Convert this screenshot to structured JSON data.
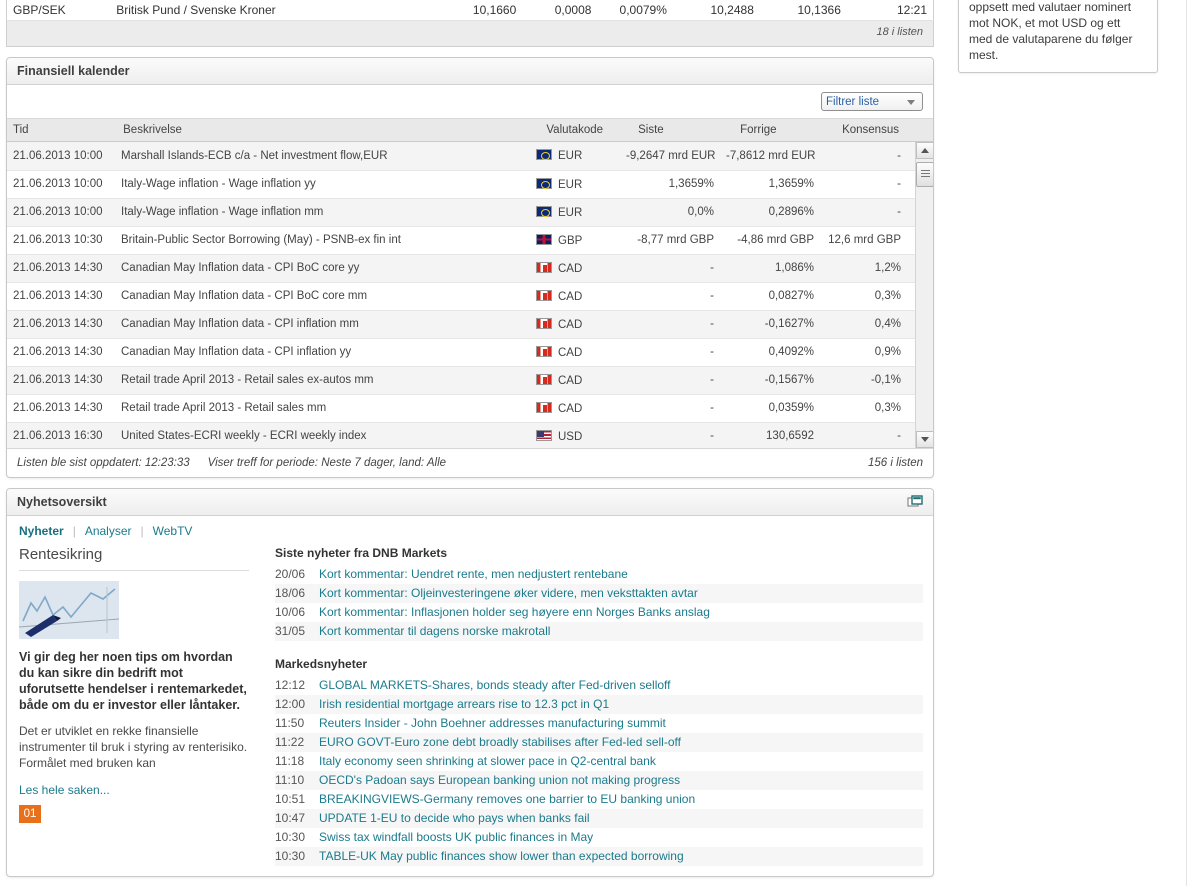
{
  "fx_row": {
    "symbol": "GBP/SEK",
    "name": "Britisk Pund / Svenske Kroner",
    "last": "10,1660",
    "change": "0,0008",
    "change_pct": "0,0079%",
    "high": "10,2488",
    "low": "10,1366",
    "time": "12:21",
    "footer": "18 i listen"
  },
  "calendar": {
    "title": "Finansiell kalender",
    "filter_label": "Filtrer liste",
    "columns": {
      "tid": "Tid",
      "beskrivelse": "Beskrivelse",
      "valutakode": "Valutakode",
      "siste": "Siste",
      "forrige": "Forrige",
      "konsensus": "Konsensus"
    },
    "rows": [
      {
        "tid": "21.06.2013 10:00",
        "beskrivelse": "Marshall Islands-ECB c/a - Net investment flow,EUR",
        "flag": "eur",
        "valutakode": "EUR",
        "siste": "-9,2647 mrd EUR",
        "forrige": "-7,8612 mrd EUR",
        "konsensus": "-"
      },
      {
        "tid": "21.06.2013 10:00",
        "beskrivelse": "Italy-Wage inflation - Wage inflation yy",
        "flag": "eur",
        "valutakode": "EUR",
        "siste": "1,3659%",
        "forrige": "1,3659%",
        "konsensus": "-"
      },
      {
        "tid": "21.06.2013 10:00",
        "beskrivelse": "Italy-Wage inflation - Wage inflation mm",
        "flag": "eur",
        "valutakode": "EUR",
        "siste": "0,0%",
        "forrige": "0,2896%",
        "konsensus": "-"
      },
      {
        "tid": "21.06.2013 10:30",
        "beskrivelse": "Britain-Public Sector Borrowing (May) - PSNB-ex fin int",
        "flag": "gbp",
        "valutakode": "GBP",
        "siste": "-8,77 mrd GBP",
        "forrige": "-4,86 mrd GBP",
        "konsensus": "12,6 mrd GBP"
      },
      {
        "tid": "21.06.2013 14:30",
        "beskrivelse": "Canadian May Inflation data - CPI BoC core yy",
        "flag": "cad",
        "valutakode": "CAD",
        "siste": "-",
        "forrige": "1,086%",
        "konsensus": "1,2%"
      },
      {
        "tid": "21.06.2013 14:30",
        "beskrivelse": "Canadian May Inflation data - CPI BoC core mm",
        "flag": "cad",
        "valutakode": "CAD",
        "siste": "-",
        "forrige": "0,0827%",
        "konsensus": "0,3%"
      },
      {
        "tid": "21.06.2013 14:30",
        "beskrivelse": "Canadian May Inflation data - CPI inflation mm",
        "flag": "cad",
        "valutakode": "CAD",
        "siste": "-",
        "forrige": "-0,1627%",
        "konsensus": "0,4%"
      },
      {
        "tid": "21.06.2013 14:30",
        "beskrivelse": "Canadian May Inflation data - CPI inflation yy",
        "flag": "cad",
        "valutakode": "CAD",
        "siste": "-",
        "forrige": "0,4092%",
        "konsensus": "0,9%"
      },
      {
        "tid": "21.06.2013 14:30",
        "beskrivelse": "Retail trade April 2013 - Retail sales ex-autos mm",
        "flag": "cad",
        "valutakode": "CAD",
        "siste": "-",
        "forrige": "-0,1567%",
        "konsensus": "-0,1%"
      },
      {
        "tid": "21.06.2013 14:30",
        "beskrivelse": "Retail trade April 2013 - Retail sales mm",
        "flag": "cad",
        "valutakode": "CAD",
        "siste": "-",
        "forrige": "0,0359%",
        "konsensus": "0,3%"
      },
      {
        "tid": "21.06.2013 16:30",
        "beskrivelse": "United States-ECRI weekly - ECRI weekly index",
        "flag": "usd",
        "valutakode": "USD",
        "siste": "-",
        "forrige": "130,6592",
        "konsensus": "-"
      }
    ],
    "footer_updated": "Listen ble sist oppdatert: 12:23:33",
    "footer_filter": "Viser treff for periode: Neste 7 dager,  land: Alle",
    "footer_count": "156 i listen"
  },
  "news": {
    "title": "Nyhetsoversikt",
    "tabs": [
      {
        "label": "Nyheter",
        "active": true
      },
      {
        "label": "Analyser",
        "active": false
      },
      {
        "label": "WebTV",
        "active": false
      }
    ],
    "feature": {
      "title": "Rentesikring",
      "lead": "Vi gir deg her noen tips om hvordan du kan sikre din bedrift mot uforutsette hendelser i rentemarkedet, både om du er investor eller låntaker.",
      "body": "Det er utviklet en rekke finansielle instrumenter til bruk i styring av renterisiko. Formålet med bruken kan",
      "read_more": "Les hele saken...",
      "pager": "01"
    },
    "dnb_group_title": "Siste nyheter fra DNB Markets",
    "dnb_items": [
      {
        "time": "20/06",
        "text": "Kort kommentar: Uendret rente, men nedjustert rentebane"
      },
      {
        "time": "18/06",
        "text": "Kort kommentar: Oljeinvesteringene øker videre, men veksttakten avtar"
      },
      {
        "time": "10/06",
        "text": "Kort kommentar: Inflasjonen holder seg høyere enn Norges Banks anslag"
      },
      {
        "time": "31/05",
        "text": "Kort kommentar til dagens norske makrotall"
      }
    ],
    "market_group_title": "Markedsnyheter",
    "market_items": [
      {
        "time": "12:12",
        "text": "GLOBAL MARKETS-Shares, bonds steady after Fed-driven selloff"
      },
      {
        "time": "12:00",
        "text": "Irish residential mortgage arrears rise to 12.3 pct in Q1"
      },
      {
        "time": "11:50",
        "text": "Reuters Insider - John Boehner addresses manufacturing summit"
      },
      {
        "time": "11:22",
        "text": "EURO GOVT-Euro zone debt broadly stabilises after Fed-led sell-off"
      },
      {
        "time": "11:18",
        "text": "Italy economy seen shrinking at slower pace in Q2-central bank"
      },
      {
        "time": "11:10",
        "text": "OECD's Padoan says European banking union not making progress"
      },
      {
        "time": "10:51",
        "text": "BREAKINGVIEWS-Germany removes one barrier to EU banking union"
      },
      {
        "time": "10:47",
        "text": "UPDATE 1-EU to decide who pays when banks fail"
      },
      {
        "time": "10:30",
        "text": "Swiss tax windfall boosts UK public finances in May"
      },
      {
        "time": "10:30",
        "text": "TABLE-UK May public finances show lower than expected borrowing"
      }
    ]
  },
  "sidebar": {
    "help_text": "Valutahandel må du lage et oppsett. Du kan senere lage flere oppsett. F.eks kan du ha ett oppsett med valutaer nominert mot NOK, et mot USD og ett med de valutaparene du følger mest."
  },
  "colors": {
    "link": "#1b7b8c",
    "accent_orange": "#e8701a",
    "panel_border": "#c8c8c8"
  }
}
